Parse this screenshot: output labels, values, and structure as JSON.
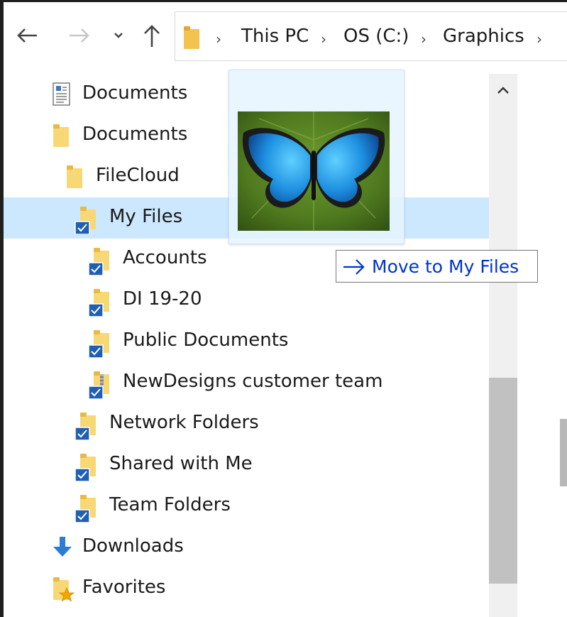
{
  "toolbar": {
    "back_icon": "back-arrow-icon",
    "forward_icon": "forward-arrow-icon",
    "recent_icon": "chevron-down-icon",
    "up_icon": "up-arrow-icon"
  },
  "address": {
    "folder_icon": "folder-icon",
    "crumbs": [
      "This PC",
      "OS (C:)",
      "Graphics"
    ]
  },
  "tree": [
    {
      "label": "Documents",
      "icon": "document-icon"
    },
    {
      "label": "Documents",
      "icon": "folder-icon"
    },
    {
      "label": "FileCloud",
      "icon": "folder-icon"
    },
    {
      "label": "My Files",
      "icon": "folder-sync-icon",
      "selected": true
    },
    {
      "label": "Accounts",
      "icon": "folder-sync-icon"
    },
    {
      "label": "DI 19-20",
      "icon": "folder-sync-icon"
    },
    {
      "label": "Public Documents",
      "icon": "folder-sync-icon"
    },
    {
      "label": "NewDesigns customer team",
      "icon": "zip-folder-sync-icon"
    },
    {
      "label": "Network Folders",
      "icon": "folder-sync-icon"
    },
    {
      "label": "Shared with Me",
      "icon": "folder-sync-icon"
    },
    {
      "label": "Team Folders",
      "icon": "folder-sync-icon"
    },
    {
      "label": "Downloads",
      "icon": "download-icon"
    },
    {
      "label": "Favorites",
      "icon": "favorites-folder-icon"
    }
  ],
  "drag": {
    "tooltip": "Move to My Files",
    "thumbnail": "butterfly-image"
  },
  "colors": {
    "selection": "#cce8ff",
    "folder": "#f8d775",
    "sync_badge": "#1f5fb4",
    "tooltip_text": "#0033cc"
  }
}
